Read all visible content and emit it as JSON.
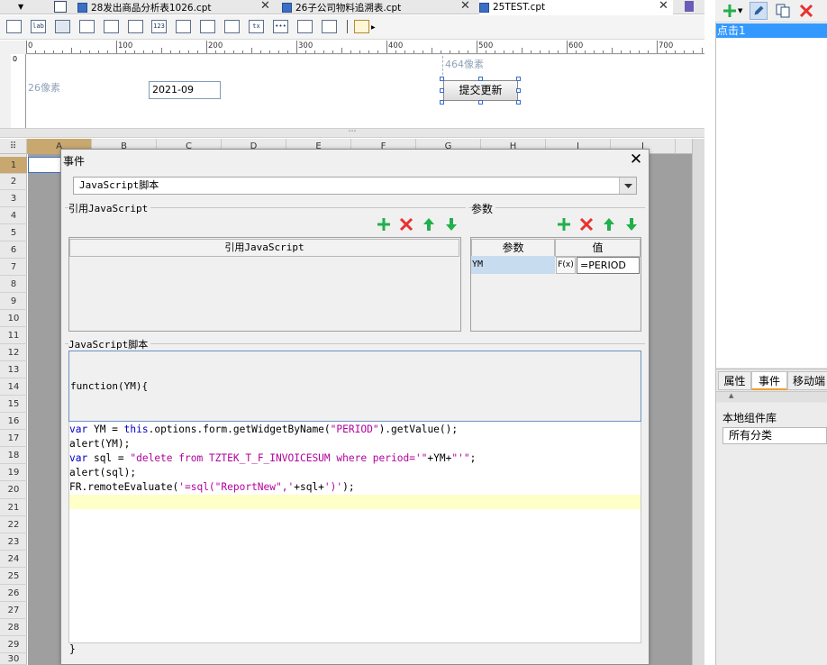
{
  "tabs": [
    {
      "label": "28发出商品分析表1026.cpt"
    },
    {
      "label": "26子公司物料追溯表.cpt"
    },
    {
      "label": "25TEST.cpt"
    }
  ],
  "toolbar": {
    "widgets": [
      "lab",
      "123"
    ]
  },
  "ruler": {
    "ticks": [
      "0",
      "100",
      "200",
      "300",
      "400",
      "500",
      "600",
      "700"
    ],
    "vertical_zero": "0"
  },
  "design": {
    "left_hint": "26像素",
    "top_hint": "464像素",
    "date_value": "2021-09",
    "submit_label": "提交更新"
  },
  "sheet": {
    "columns": [
      "A",
      "B",
      "C",
      "D",
      "E",
      "F",
      "G",
      "H",
      "I",
      "J"
    ],
    "rows": [
      "1",
      "2",
      "3",
      "4",
      "5",
      "6",
      "7",
      "8",
      "9",
      "10",
      "11",
      "12",
      "13",
      "14",
      "15",
      "16",
      "17",
      "18",
      "19",
      "20",
      "21",
      "22",
      "23",
      "24",
      "25",
      "26",
      "27",
      "28",
      "29",
      "30"
    ]
  },
  "right_panel": {
    "selected_event": "点击1",
    "tabs": [
      "属性",
      "事件",
      "移动端"
    ],
    "library_label": "本地组件库",
    "library_select": "所有分类"
  },
  "dialog": {
    "title": "事件",
    "close": "✕",
    "type_select": "JavaScript脚本",
    "ref_js_group": "引用JavaScript",
    "ref_js_header": "引用JavaScript",
    "params_group": "参数",
    "params_header_name": "参数",
    "params_header_value": "值",
    "param": {
      "name": "YM",
      "fx": "F(x)",
      "value": "=PERIOD"
    },
    "script_group": "JavaScript脚本",
    "function_signature": "function(YM){",
    "code_lines": [
      [
        {
          "t": "var",
          "c": "kw"
        },
        {
          "t": " YM = "
        },
        {
          "t": "this",
          "c": "kw"
        },
        {
          "t": ".options.form.getWidgetByName("
        },
        {
          "t": "\"PERIOD\"",
          "c": "str"
        },
        {
          "t": ").getValue();"
        }
      ],
      [
        {
          "t": "alert(YM);"
        }
      ],
      [
        {
          "t": "var",
          "c": "kw"
        },
        {
          "t": " sql = "
        },
        {
          "t": "\"delete from TZTEK_T_F_INVOICESUM where period='\"",
          "c": "str"
        },
        {
          "t": "+YM+"
        },
        {
          "t": "\"'\"",
          "c": "str"
        },
        {
          "t": ";"
        }
      ],
      [
        {
          "t": "alert(sql);"
        }
      ],
      [
        {
          "t": "FR.remoteEvaluate("
        },
        {
          "t": "'=sql(\"ReportNew\",'",
          "c": "str"
        },
        {
          "t": "+sql+"
        },
        {
          "t": "')'",
          "c": "str"
        },
        {
          "t": ");"
        }
      ]
    ],
    "closing_brace": "}"
  },
  "colors": {
    "add": "#21b04b",
    "delete": "#e8312f",
    "move": "#21b04b",
    "selection": "#3399ff",
    "keyword": "#0000c8",
    "string": "#b4009e"
  }
}
